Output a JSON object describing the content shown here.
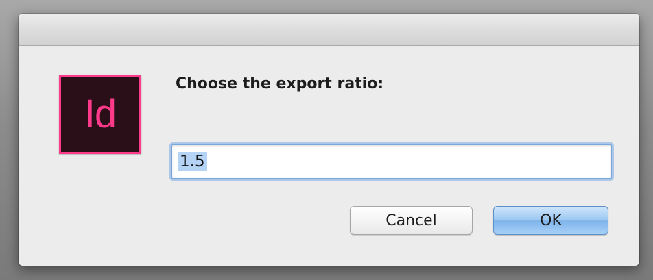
{
  "dialog": {
    "icon": {
      "name": "adobe-indesign-icon",
      "text": "Id",
      "colors": {
        "background": "#2a0f18",
        "accent": "#ff3a8a"
      }
    },
    "prompt": "Choose the export ratio:",
    "input": {
      "value": "1.5",
      "selected": true
    },
    "buttons": {
      "cancel": "Cancel",
      "ok": "OK"
    }
  }
}
